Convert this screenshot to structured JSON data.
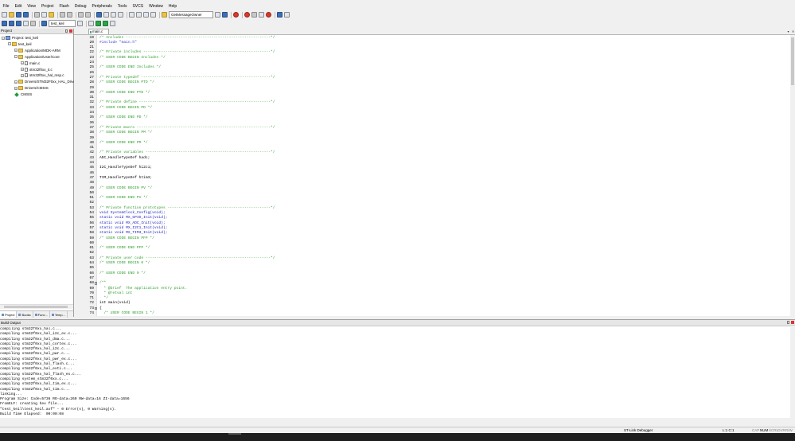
{
  "menu": [
    "File",
    "Edit",
    "View",
    "Project",
    "Flash",
    "Debug",
    "Peripherals",
    "Tools",
    "SVCS",
    "Window",
    "Help"
  ],
  "toolbar": {
    "function_combo": "GetMessageOwner",
    "target_combo": "test_keil"
  },
  "project_panel": {
    "title": "Project",
    "tree": [
      {
        "label": "Project: test_keil",
        "level": 0,
        "kind": "project",
        "expander": "−"
      },
      {
        "label": "test_keil",
        "level": 1,
        "kind": "folder",
        "expander": "−"
      },
      {
        "label": "Application/MDK-ARM",
        "level": 2,
        "kind": "folder",
        "expander": "+"
      },
      {
        "label": "Application/User/Core",
        "level": 2,
        "kind": "folder",
        "expander": "−"
      },
      {
        "label": "main.c",
        "level": 3,
        "kind": "file",
        "expander": "+"
      },
      {
        "label": "stm32f0xx_it.c",
        "level": 3,
        "kind": "file",
        "expander": "+"
      },
      {
        "label": "stm32f0xx_hal_msp.c",
        "level": 3,
        "kind": "file",
        "expander": "+"
      },
      {
        "label": "Drivers/STM32F0xx_HAL_Driver",
        "level": 2,
        "kind": "folder",
        "expander": "+"
      },
      {
        "label": "Drivers/CMSIS",
        "level": 2,
        "kind": "folder",
        "expander": "+"
      },
      {
        "label": "CMSIS",
        "level": 2,
        "kind": "diamond",
        "expander": ""
      }
    ],
    "tabs": [
      "Project",
      "Books",
      "Func...",
      "Temp..."
    ]
  },
  "editor": {
    "tab": "main.c",
    "lines": [
      {
        "n": "19",
        "t": "/* Includes ------------------------------------------------------------------*/",
        "c": "comment"
      },
      {
        "n": "20",
        "t": "#include \"main.h\"",
        "c": "pre"
      },
      {
        "n": "21",
        "t": "",
        "c": "normal"
      },
      {
        "n": "22",
        "t": "/* Private includes ----------------------------------------------------------*/",
        "c": "comment"
      },
      {
        "n": "23",
        "t": "/* USER CODE BEGIN Includes */",
        "c": "comment"
      },
      {
        "n": "24",
        "t": "",
        "c": "normal"
      },
      {
        "n": "25",
        "t": "/* USER CODE END Includes */",
        "c": "comment"
      },
      {
        "n": "26",
        "t": "",
        "c": "normal"
      },
      {
        "n": "27",
        "t": "/* Private typedef -----------------------------------------------------------*/",
        "c": "comment"
      },
      {
        "n": "28",
        "t": "/* USER CODE BEGIN PTD */",
        "c": "comment"
      },
      {
        "n": "29",
        "t": "",
        "c": "normal"
      },
      {
        "n": "30",
        "t": "/* USER CODE END PTD */",
        "c": "comment"
      },
      {
        "n": "31",
        "t": "",
        "c": "normal"
      },
      {
        "n": "32",
        "t": "/* Private define ------------------------------------------------------------*/",
        "c": "comment"
      },
      {
        "n": "33",
        "t": "/* USER CODE BEGIN PD */",
        "c": "comment"
      },
      {
        "n": "34",
        "t": "",
        "c": "normal"
      },
      {
        "n": "35",
        "t": "/* USER CODE END PD */",
        "c": "comment"
      },
      {
        "n": "36",
        "t": "",
        "c": "normal"
      },
      {
        "n": "37",
        "t": "/* Private macro -------------------------------------------------------------*/",
        "c": "comment"
      },
      {
        "n": "38",
        "t": "/* USER CODE BEGIN PM */",
        "c": "comment"
      },
      {
        "n": "39",
        "t": "",
        "c": "normal"
      },
      {
        "n": "40",
        "t": "/* USER CODE END PM */",
        "c": "comment"
      },
      {
        "n": "41",
        "t": "",
        "c": "normal"
      },
      {
        "n": "42",
        "t": "/* Private variables ---------------------------------------------------------*/",
        "c": "comment"
      },
      {
        "n": "43",
        "t": "ADC_HandleTypeDef hadc;",
        "c": "normal"
      },
      {
        "n": "44",
        "t": "",
        "c": "normal"
      },
      {
        "n": "45",
        "t": "I2C_HandleTypeDef hi2c1;",
        "c": "normal"
      },
      {
        "n": "46",
        "t": "",
        "c": "normal"
      },
      {
        "n": "47",
        "t": "TIM_HandleTypeDef htim3;",
        "c": "normal"
      },
      {
        "n": "48",
        "t": "",
        "c": "normal"
      },
      {
        "n": "49",
        "t": "/* USER CODE BEGIN PV */",
        "c": "comment"
      },
      {
        "n": "50",
        "t": "",
        "c": "normal"
      },
      {
        "n": "51",
        "t": "/* USER CODE END PV */",
        "c": "comment"
      },
      {
        "n": "52",
        "t": "",
        "c": "normal"
      },
      {
        "n": "53",
        "t": "/* Private function prototypes -----------------------------------------------*/",
        "c": "comment"
      },
      {
        "n": "54",
        "t": "void SystemClock_Config(void);",
        "c": "kw"
      },
      {
        "n": "55",
        "t": "static void MX_GPIO_Init(void);",
        "c": "kw"
      },
      {
        "n": "56",
        "t": "static void MX_ADC_Init(void);",
        "c": "kw"
      },
      {
        "n": "57",
        "t": "static void MX_I2C1_Init(void);",
        "c": "kw"
      },
      {
        "n": "58",
        "t": "static void MX_TIM3_Init(void);",
        "c": "kw"
      },
      {
        "n": "59",
        "t": "/* USER CODE BEGIN PFP */",
        "c": "comment"
      },
      {
        "n": "60",
        "t": "",
        "c": "normal"
      },
      {
        "n": "61",
        "t": "/* USER CODE END PFP */",
        "c": "comment"
      },
      {
        "n": "62",
        "t": "",
        "c": "normal"
      },
      {
        "n": "63",
        "t": "/* Private user code ---------------------------------------------------------*/",
        "c": "comment"
      },
      {
        "n": "64",
        "t": "/* USER CODE BEGIN 0 */",
        "c": "comment"
      },
      {
        "n": "65",
        "t": "",
        "c": "normal"
      },
      {
        "n": "66",
        "t": "/* USER CODE END 0 */",
        "c": "comment"
      },
      {
        "n": "67",
        "t": "",
        "c": "normal"
      },
      {
        "n": "68",
        "t": "/**",
        "c": "comment",
        "fold": "−"
      },
      {
        "n": "69",
        "t": "  * @brief  The application entry point.",
        "c": "comment"
      },
      {
        "n": "70",
        "t": "  * @retval int",
        "c": "comment"
      },
      {
        "n": "71",
        "t": "  */",
        "c": "comment"
      },
      {
        "n": "72",
        "t": "int main(void)",
        "c": "normal"
      },
      {
        "n": "73",
        "t": "{",
        "c": "normal",
        "fold": "−"
      },
      {
        "n": "74",
        "t": "  /* USER CODE BEGIN 1 */",
        "c": "comment"
      }
    ]
  },
  "build_output": {
    "title": "Build Output",
    "lines": [
      "compiling stm32f0xx_hal.c...",
      "compiling stm32f0xx_hal_i2c_ex.c...",
      "compiling stm32f0xx_hal_dma.c...",
      "compiling stm32f0xx_hal_cortex.c...",
      "compiling stm32f0xx_hal_i2c.c...",
      "compiling stm32f0xx_hal_pwr.c...",
      "compiling stm32f0xx_hal_pwr_ex.c...",
      "compiling stm32f0xx_hal_flash.c...",
      "compiling stm32f0xx_hal_exti.c...",
      "compiling stm32f0xx_hal_flash_ex.c...",
      "compiling system_stm32f0xx.c...",
      "compiling stm32f0xx_hal_tim_ex.c...",
      "compiling stm32f0xx_hal_tim.c...",
      "linking...",
      "Program Size: Code=5736 RO-data=260 RW-data=16 ZI-data=1656",
      "FromELF: creating hex file...",
      "\"test_keil\\test_keil.axf\" - 0 Error(s), 0 Warning(s).",
      "Build Time Elapsed:  00:00:08"
    ]
  },
  "status": {
    "debugger": "ST-Link Debugger",
    "position": "L:1 C:1",
    "cap": "CAP",
    "num": "NUM",
    "scrl": "SCRL",
    "ovr": "OVR",
    "rw": "R/W"
  },
  "colors": {
    "comment": "#2e9d2e",
    "preprocessor": "#3b3bd8",
    "keyword": "#2020c0"
  }
}
